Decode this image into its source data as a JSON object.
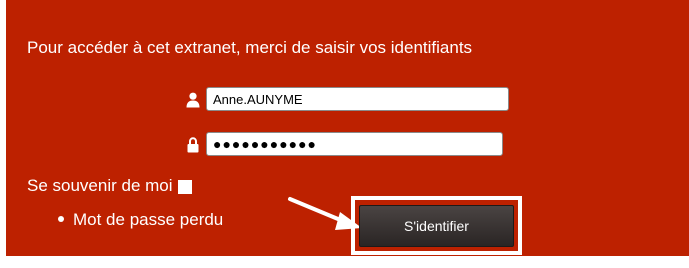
{
  "login": {
    "intro_text": "Pour accéder à cet extranet, merci de saisir vos identifiants",
    "username_value": "Anne.AUNYME",
    "password_value": "●●●●●●●●●●●",
    "remember_label": "Se souvenir de moi",
    "remember_checked": false,
    "forgot_link": "Mot de passe perdu",
    "submit_label": "S'identifier"
  },
  "icons": {
    "user": "user-icon",
    "lock": "lock-icon",
    "arrow": "arrow-icon"
  },
  "colors": {
    "panel_background": "#bd2100",
    "button_background": "#2e2827",
    "text": "#ffffff"
  }
}
